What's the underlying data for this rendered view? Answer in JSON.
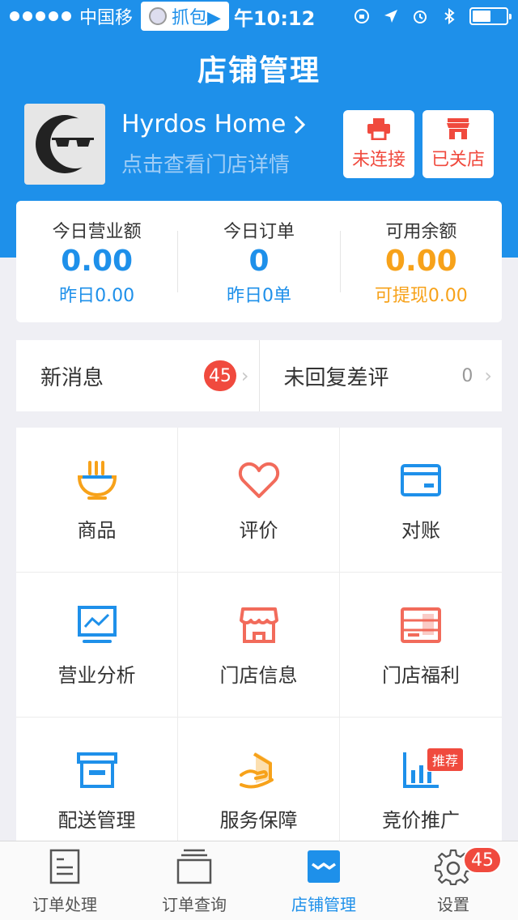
{
  "status_bar": {
    "carrier": "中国移",
    "capture_label": "抓包▶",
    "time": "午10:12"
  },
  "header": {
    "title": "店铺管理"
  },
  "shop": {
    "name": "Hyrdos Home",
    "subtitle": "点击查看门店详情",
    "connect_label": "未连接",
    "store_status_label": "已关店"
  },
  "stats": [
    {
      "label": "今日营业额",
      "value": "0.00",
      "sub": "昨日0.00"
    },
    {
      "label": "今日订单",
      "value": "0",
      "sub": "昨日0单"
    },
    {
      "label": "可用余额",
      "value": "0.00",
      "sub": "可提现0.00"
    }
  ],
  "messages": {
    "new_label": "新消息",
    "new_count": "45",
    "review_label": "未回复差评",
    "review_count": "0"
  },
  "grid": [
    {
      "label": "商品",
      "icon": "bowl-icon"
    },
    {
      "label": "评价",
      "icon": "heart-icon"
    },
    {
      "label": "对账",
      "icon": "card-icon"
    },
    {
      "label": "营业分析",
      "icon": "chart-monitor-icon"
    },
    {
      "label": "门店信息",
      "icon": "store-icon"
    },
    {
      "label": "门店福利",
      "icon": "gift-icon"
    },
    {
      "label": "配送管理",
      "icon": "box-icon"
    },
    {
      "label": "服务保障",
      "icon": "shield-hand-icon"
    },
    {
      "label": "竞价推广",
      "icon": "bar-chart-icon",
      "tag": "推荐"
    }
  ],
  "tabbar": [
    {
      "label": "订单处理"
    },
    {
      "label": "订单查询"
    },
    {
      "label": "店铺管理",
      "active": true
    },
    {
      "label": "设置",
      "badge": "45"
    }
  ],
  "colors": {
    "primary": "#1e90ea",
    "accent_red": "#f04a3e",
    "accent_orange": "#f7a21a"
  }
}
